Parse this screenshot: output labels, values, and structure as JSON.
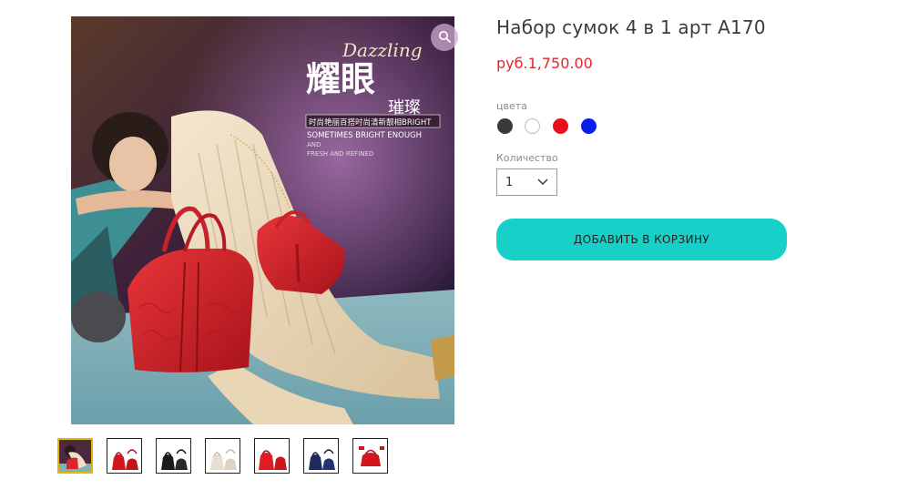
{
  "product": {
    "title": "Набор сумок 4 в 1 арт А170",
    "price": "руб.1,750.00"
  },
  "image_overlay": {
    "script_text": "Dazzling",
    "cjk_headline": "耀眼",
    "cjk_sub": "璀璨",
    "cjk_tagline": "时尚艳丽百搭时尚清新靓相BRIGHT",
    "line1": "SOMETIMES BRIGHT ENOUGH",
    "line2": "AND",
    "line3": "FRESH AND REFINED"
  },
  "colors": {
    "label": "цвета",
    "options": [
      "#3a3a3a",
      "#ffffff",
      "#e8101a",
      "#0a1ef0"
    ]
  },
  "quantity": {
    "label": "Количество",
    "value": "1"
  },
  "cart_button": {
    "label": "ДОБАВИТЬ В КОРЗИНУ",
    "color": "#17d1c9"
  },
  "icons": {
    "zoom": "magnifier-icon",
    "select_arrow": "chevron-down-icon"
  },
  "thumbnails": [
    {
      "name": "model-red-bags"
    },
    {
      "name": "red-bag-set"
    },
    {
      "name": "black-bag-set"
    },
    {
      "name": "beige-bag-set"
    },
    {
      "name": "red-bag-set-2"
    },
    {
      "name": "navy-bag-set"
    },
    {
      "name": "red-bag-detail"
    }
  ]
}
